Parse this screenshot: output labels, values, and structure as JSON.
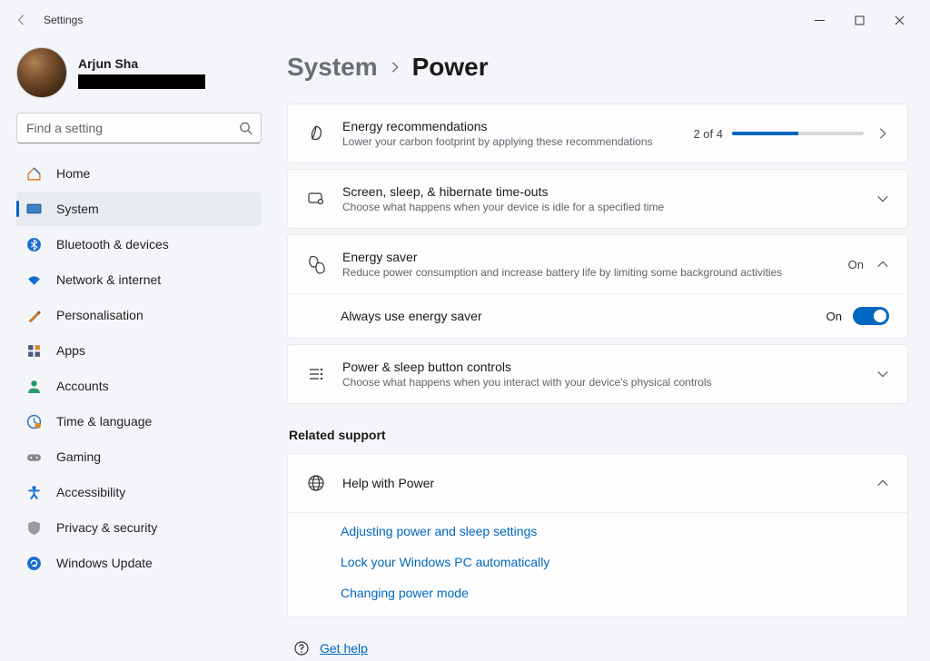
{
  "window": {
    "title": "Settings"
  },
  "user": {
    "name": "Arjun Sha"
  },
  "search": {
    "placeholder": "Find a setting"
  },
  "nav": {
    "items": [
      {
        "label": "Home"
      },
      {
        "label": "System"
      },
      {
        "label": "Bluetooth & devices"
      },
      {
        "label": "Network & internet"
      },
      {
        "label": "Personalisation"
      },
      {
        "label": "Apps"
      },
      {
        "label": "Accounts"
      },
      {
        "label": "Time & language"
      },
      {
        "label": "Gaming"
      },
      {
        "label": "Accessibility"
      },
      {
        "label": "Privacy & security"
      },
      {
        "label": "Windows Update"
      }
    ]
  },
  "breadcrumb": {
    "parent": "System",
    "current": "Power"
  },
  "cards": {
    "energy_rec": {
      "title": "Energy recommendations",
      "sub": "Lower your carbon footprint by applying these recommendations",
      "progress_label": "2 of 4",
      "progress_pct": 50
    },
    "screen_sleep": {
      "title": "Screen, sleep, & hibernate time-outs",
      "sub": "Choose what happens when your device is idle for a specified time"
    },
    "energy_saver": {
      "title": "Energy saver",
      "sub": "Reduce power consumption and increase battery life by limiting some background activities",
      "state": "On",
      "subrow": {
        "label": "Always use energy saver",
        "state": "On"
      }
    },
    "buttons": {
      "title": "Power & sleep button controls",
      "sub": "Choose what happens when you interact with your device's physical controls"
    }
  },
  "related": {
    "heading": "Related support",
    "help_with": {
      "title": "Help with Power"
    },
    "links": [
      "Adjusting power and sleep settings",
      "Lock your Windows PC automatically",
      "Changing power mode"
    ]
  },
  "footer": {
    "get_help": "Get help"
  }
}
